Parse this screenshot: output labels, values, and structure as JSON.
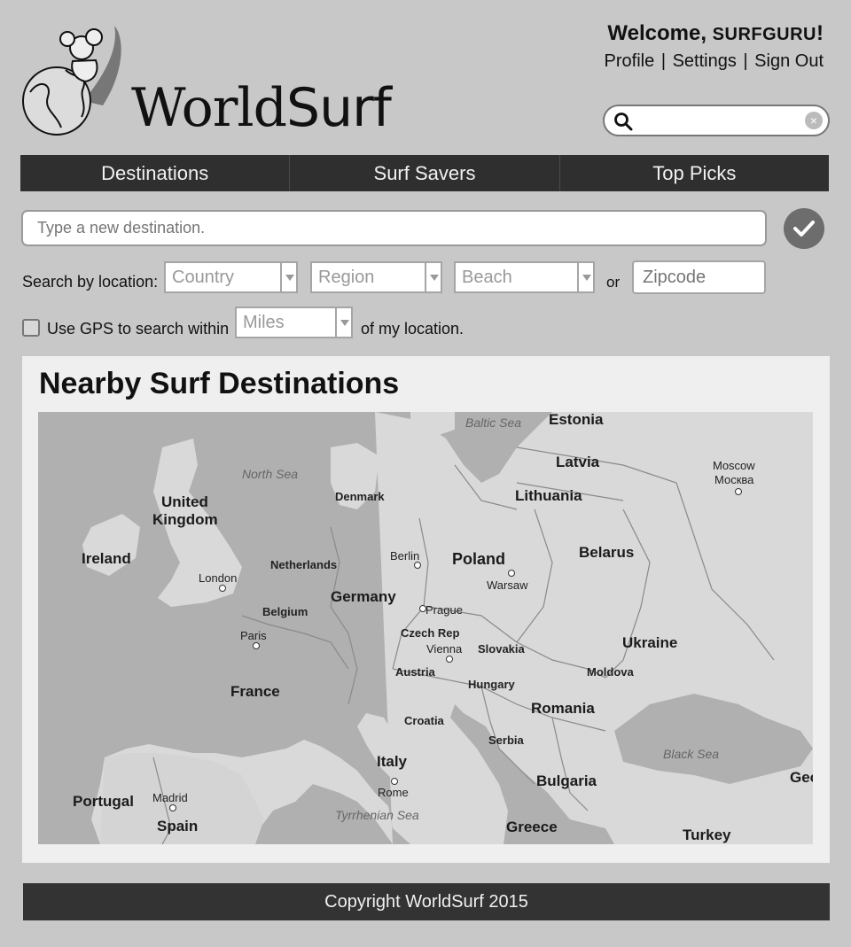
{
  "brand": {
    "name_part1": "World",
    "name_part2": "Surf"
  },
  "account": {
    "welcome_prefix": "Welcome, ",
    "username": "SURFGURU",
    "welcome_suffix": "!",
    "links": [
      "Profile",
      "Settings",
      "Sign Out"
    ],
    "separator": "|"
  },
  "search": {
    "value": "",
    "clear_icon": "×"
  },
  "nav": {
    "items": [
      "Destinations",
      "Surf Savers",
      "Top Picks"
    ]
  },
  "destination": {
    "placeholder": "Type a new destination."
  },
  "location_search": {
    "label": "Search by location:",
    "country": "Country",
    "region": "Region",
    "beach": "Beach",
    "or_label": "or",
    "zipcode_placeholder": "Zipcode"
  },
  "gps": {
    "label_before": "Use GPS to search within",
    "miles": "Miles",
    "label_after": "of my location.",
    "checked": false
  },
  "nearby": {
    "title": "Nearby Surf Destinations",
    "map_labels": {
      "baltic_sea": "Baltic Sea",
      "estonia": "Estonia",
      "latvia": "Latvia",
      "moscow": "Moscow",
      "moscow_ru": "Москва",
      "north_sea": "North Sea",
      "denmark": "Denmark",
      "lithuania": "Lithuania",
      "united_kingdom_1": "United",
      "united_kingdom_2": "Kingdom",
      "ireland": "Ireland",
      "netherlands": "Netherlands",
      "berlin": "Berlin",
      "poland": "Poland",
      "belarus": "Belarus",
      "london": "London",
      "warsaw": "Warsaw",
      "germany": "Germany",
      "belgium": "Belgium",
      "prague": "Prague",
      "paris": "Paris",
      "czech_rep": "Czech Rep",
      "ukraine": "Ukraine",
      "vienna": "Vienna",
      "slovakia": "Slovakia",
      "austria": "Austria",
      "moldova": "Moldova",
      "france": "France",
      "hungary": "Hungary",
      "romania": "Romania",
      "croatia": "Croatia",
      "serbia": "Serbia",
      "black_sea": "Black Sea",
      "italy": "Italy",
      "bulgaria": "Bulgaria",
      "geo": "Geo",
      "portugal": "Portugal",
      "madrid": "Madrid",
      "rome": "Rome",
      "spain": "Spain",
      "tyrrhenian_sea": "Tyrrhenian Sea",
      "greece": "Greece",
      "turkey": "Turkey"
    }
  },
  "footer": {
    "text": "Copyright WorldSurf 2015"
  },
  "colors": {
    "page_bg": "#c8c8c8",
    "nav_bg": "#2f2f2f",
    "footer_bg": "#333333",
    "panel_bg": "#efefef",
    "confirm_button": "#6d6d6d"
  },
  "icons": {
    "logo": "globe-with-surfer-logo",
    "search": "search-icon",
    "clear": "clear-icon",
    "confirm": "checkmark-icon",
    "dropdown": "chevron-down-icon"
  }
}
